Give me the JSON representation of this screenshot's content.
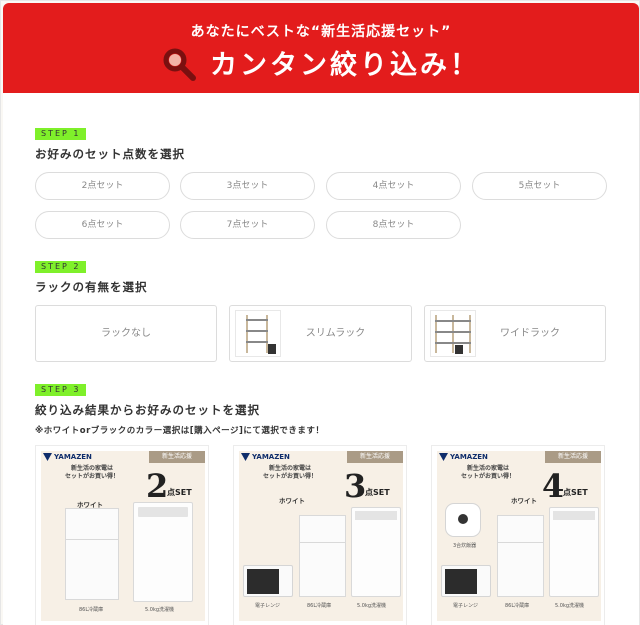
{
  "header": {
    "subtitle": "あなたにベストな“新生活応援セット”",
    "title": "カンタン絞り込み！"
  },
  "steps": [
    {
      "badge": "STEP 1",
      "title": "お好みのセット点数を選択"
    },
    {
      "badge": "STEP 2",
      "title": "ラックの有無を選択"
    },
    {
      "badge": "STEP 3",
      "title": "絞り込み結果からお好みのセットを選択"
    }
  ],
  "set_counts": [
    "2点セット",
    "3点セット",
    "4点セット",
    "5点セット",
    "6点セット",
    "7点セット",
    "8点セット"
  ],
  "racks": [
    "ラックなし",
    "スリムラック",
    "ワイドラック"
  ],
  "note": "※ホワイトorブラックのカラー選択は[購入ページ]にて選択できます！",
  "cards": [
    {
      "brand": "YAMAZEN",
      "tag": "新生活応援",
      "catch_line1": "新生活の家電は",
      "catch_line2": "セットがお買い得！",
      "number": "2",
      "set_suffix": "点SET",
      "color_label": "ホワイト",
      "cap_fridge": "86L冷蔵庫",
      "cap_washer": "5.0kg洗濯機"
    },
    {
      "brand": "YAMAZEN",
      "tag": "新生活応援",
      "catch_line1": "新生活の家電は",
      "catch_line2": "セットがお買い得！",
      "number": "3",
      "set_suffix": "点SET",
      "color_label": "ホワイト",
      "cap_micro": "電子レンジ",
      "cap_fridge": "86L冷蔵庫",
      "cap_washer": "5.0kg洗濯機"
    },
    {
      "brand": "YAMAZEN",
      "tag": "新生活応援",
      "catch_line1": "新生活の家電は",
      "catch_line2": "セットがお買い得！",
      "number": "4",
      "set_suffix": "点SET",
      "color_label": "ホワイト",
      "cap_cooker": "3合炊飯器",
      "cap_micro": "電子レンジ",
      "cap_fridge": "86L冷蔵庫",
      "cap_washer": "5.0kg洗濯機"
    }
  ],
  "colors": {
    "header_red": "#e31c1c",
    "step_green": "#7ff02a"
  }
}
